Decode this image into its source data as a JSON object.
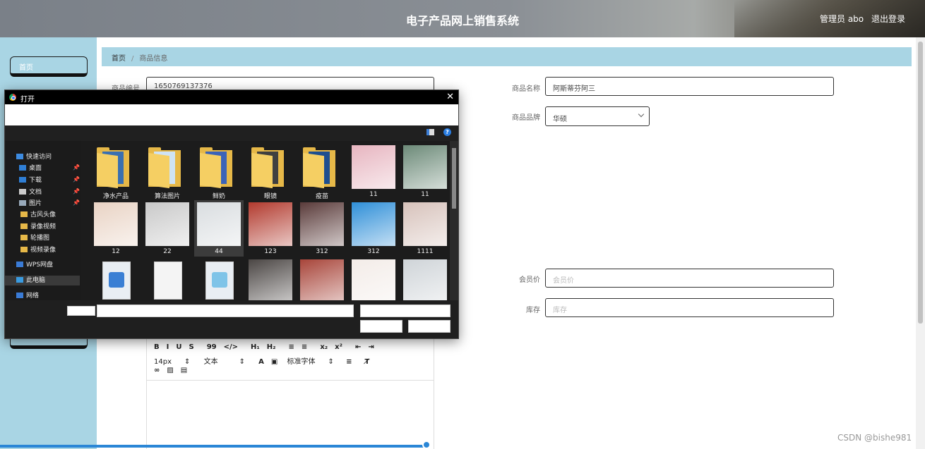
{
  "header": {
    "title": "电子产品网上销售系统",
    "user": "管理员 abo",
    "logout": "退出登录"
  },
  "sidebar": {
    "items": [
      {
        "label": "首页"
      }
    ]
  },
  "breadcrumb": {
    "home": "首页",
    "current": "商品信息"
  },
  "form": {
    "code_label": "商品编号",
    "code_value": "1650769137376",
    "name_label": "商品名称",
    "name_value": "阿斯蒂芬阿三",
    "brand_label": "商品品牌",
    "brand_value": "华硕",
    "member_price_label": "会员价",
    "member_price_placeholder": "会员价",
    "stock_label": "库存",
    "stock_placeholder": "库存"
  },
  "editor": {
    "toolbar_row1": [
      "B",
      "I",
      "U",
      "S",
      "99",
      "</>",
      "H₁",
      "H₂",
      "≡",
      "≡",
      "x₂",
      "x²",
      "⇤",
      "⇥"
    ],
    "font_size": "14px",
    "text_style": "文本",
    "font_family": "标准字体"
  },
  "dialog": {
    "title": "打开",
    "nav": [
      {
        "label": "快速访问"
      },
      {
        "label": "桌面"
      },
      {
        "label": "下载"
      },
      {
        "label": "文档"
      },
      {
        "label": "图片"
      },
      {
        "label": "古风头像"
      },
      {
        "label": "录像视频"
      },
      {
        "label": "轮播图"
      },
      {
        "label": "视频录像"
      },
      {
        "label": "WPS网盘"
      },
      {
        "label": "此电脑"
      },
      {
        "label": "网络"
      }
    ],
    "files": [
      {
        "name": "净水产品",
        "kind": "folder",
        "color": "#3a6fb0"
      },
      {
        "name": "算法图片",
        "kind": "folder",
        "color": "#cfe3f5"
      },
      {
        "name": "鲜奶",
        "kind": "folder",
        "color": "#3b63b8"
      },
      {
        "name": "眼镜",
        "kind": "folder",
        "color": "#404040"
      },
      {
        "name": "疫苗",
        "kind": "folder",
        "color": "#1e4f8f"
      },
      {
        "name": "11",
        "kind": "image",
        "color": "#e7b5c0"
      },
      {
        "name": "11",
        "kind": "image",
        "color": "#6c8a78"
      },
      {
        "name": "12",
        "kind": "image",
        "color": "#e9d3c4"
      },
      {
        "name": "22",
        "kind": "image",
        "color": "#c9c9c9"
      },
      {
        "name": "44",
        "kind": "image",
        "color": "#d9dde0"
      },
      {
        "name": "123",
        "kind": "image",
        "color": "#b23a2e"
      },
      {
        "name": "312",
        "kind": "image",
        "color": "#5a3b3a"
      },
      {
        "name": "312",
        "kind": "image",
        "color": "#2f8fd8"
      },
      {
        "name": "1111",
        "kind": "image",
        "color": "#d7c2bb"
      },
      {
        "name": "",
        "kind": "video",
        "color": "#3a7fd4"
      },
      {
        "name": "",
        "kind": "doc",
        "color": "#f0f0f0"
      },
      {
        "name": "",
        "kind": "gif",
        "color": "#7fc4e8"
      },
      {
        "name": "",
        "kind": "image",
        "color": "#4b4644"
      },
      {
        "name": "",
        "kind": "image",
        "color": "#a8453a"
      },
      {
        "name": "",
        "kind": "image",
        "color": "#f3ece8"
      },
      {
        "name": "",
        "kind": "image",
        "color": "#cfd4d8"
      }
    ]
  },
  "watermark": "CSDN @bishe981"
}
